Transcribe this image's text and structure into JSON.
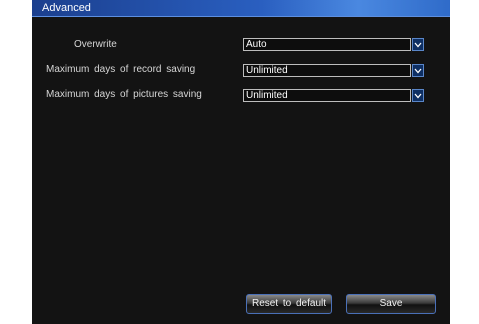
{
  "window": {
    "title": "Advanced"
  },
  "rows": [
    {
      "label": "Overwrite",
      "value": "Auto"
    },
    {
      "label": "Maximum days of record saving",
      "value": "Unlimited"
    },
    {
      "label": "Maximum days of pictures saving",
      "value": "Unlimited"
    }
  ],
  "icons": {
    "dropdown": "chevron-down-icon"
  },
  "buttons": {
    "reset_label": "Reset to default",
    "save_label": "Save"
  },
  "colors": {
    "title_bar": "#2a5fc0",
    "panel_bg": "#131313",
    "accent_border": "#4a70b8"
  }
}
